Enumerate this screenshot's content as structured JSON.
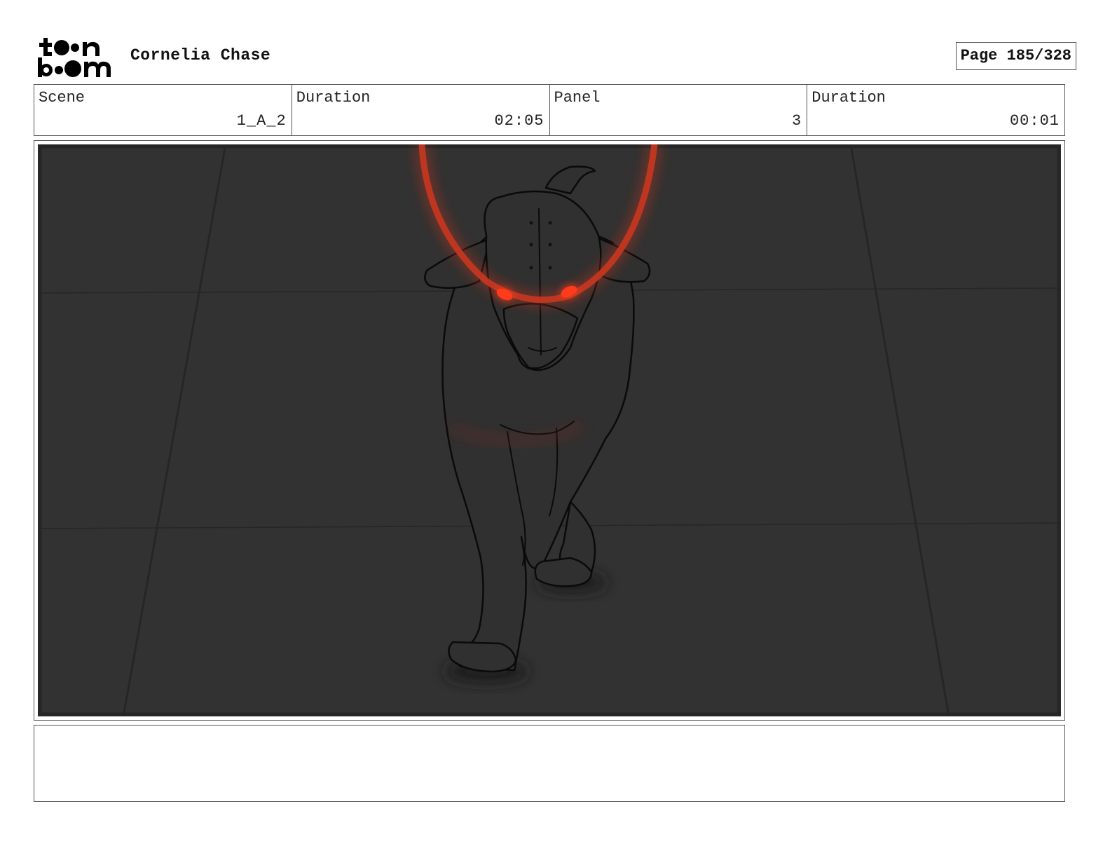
{
  "header": {
    "logo_text": "toon boom",
    "project_title": "Cornelia Chase",
    "page_label": "Page 185/328"
  },
  "info": [
    {
      "label": "Scene",
      "value": "1_A_2"
    },
    {
      "label": "Duration",
      "value": "02:05"
    },
    {
      "label": "Panel",
      "value": "3"
    },
    {
      "label": "Duration",
      "value": "00:01"
    }
  ],
  "panel": {
    "description": "",
    "colors": {
      "background": "#323232",
      "glow": "#c0301c",
      "eyes": "#ff3a1a"
    }
  },
  "notes": {
    "text": ""
  }
}
